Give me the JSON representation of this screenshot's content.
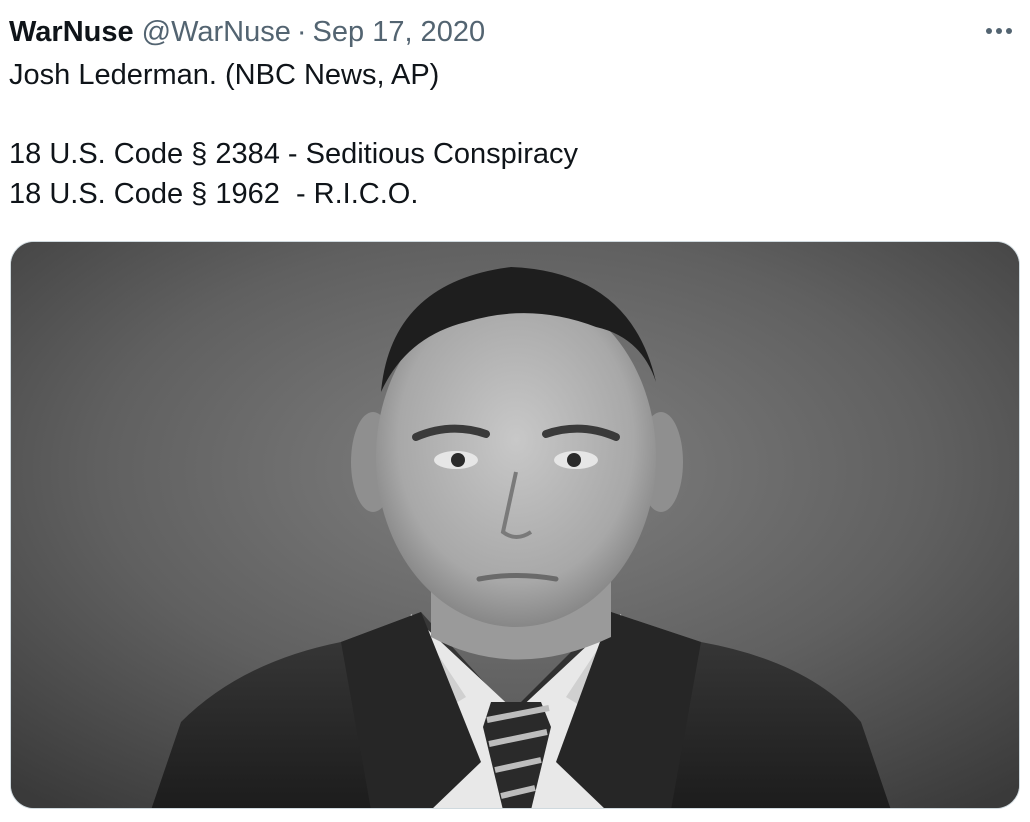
{
  "tweet": {
    "display_name": "WarNuse",
    "handle": "@WarNuse",
    "separator": "·",
    "date": "Sep 17, 2020",
    "more_icon": "more-horizontal-icon",
    "text_lines": [
      "Josh Lederman. (NBC News, AP)",
      "",
      "18 U.S. Code § 2384 - Seditious Conspiracy",
      "18 U.S. Code § 1962  - R.I.C.O."
    ],
    "media": {
      "kind": "black-and-white portrait photo of a man in a dark suit and striped tie"
    }
  },
  "colors": {
    "text_primary": "#0f1419",
    "text_secondary": "#536471",
    "border": "#cfd9de"
  }
}
